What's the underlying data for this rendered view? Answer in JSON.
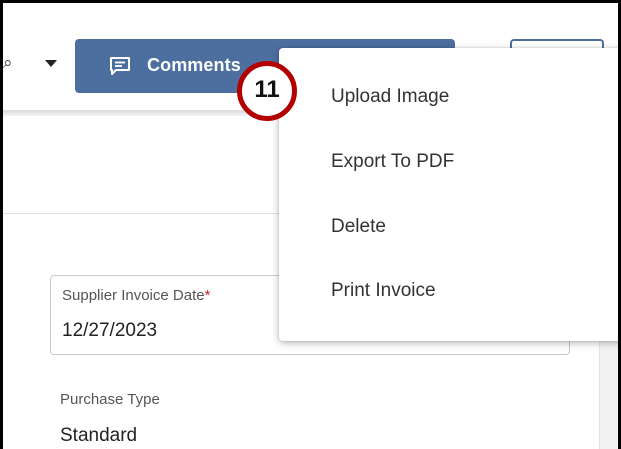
{
  "toolbar": {
    "comments_label": "Comments"
  },
  "menu": {
    "items": [
      {
        "label": "Upload Image"
      },
      {
        "label": "Export To PDF"
      },
      {
        "label": "Delete"
      },
      {
        "label": "Print Invoice"
      }
    ]
  },
  "callout": {
    "number": "11"
  },
  "form": {
    "supplier_invoice_date": {
      "label": "Supplier Invoice Date",
      "required_marker": "*",
      "value": "12/27/2023"
    },
    "purchase_type": {
      "label": "Purchase Type",
      "value": "Standard"
    }
  },
  "colors": {
    "primary": "#4c6fa0",
    "callout_ring": "#b20000",
    "required": "#c62828"
  },
  "icons": {
    "comments": "comment-bubble-icon",
    "caret": "chevron-down-icon"
  }
}
